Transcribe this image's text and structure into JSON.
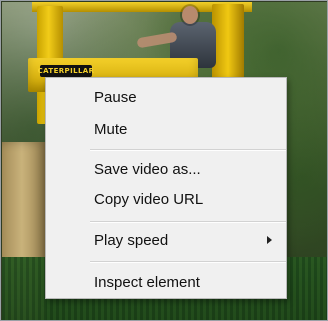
{
  "context_menu": {
    "items": [
      {
        "label": "Pause"
      },
      {
        "label": "Mute"
      },
      {
        "label": "Save video as..."
      },
      {
        "label": "Copy video URL"
      },
      {
        "label": "Play speed"
      },
      {
        "label": "Inspect element"
      }
    ],
    "play_speed_has_submenu": true
  },
  "video": {
    "badge_text": "CATERPILLAR"
  },
  "icons": {
    "submenu_arrow": "chevron-right-icon"
  }
}
